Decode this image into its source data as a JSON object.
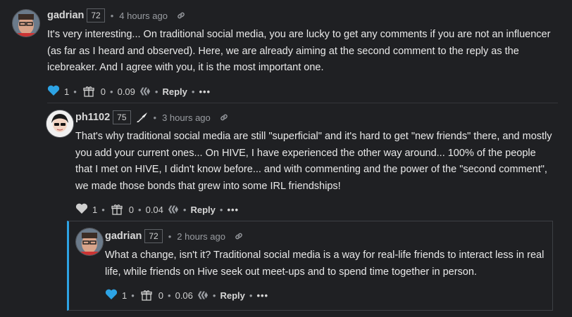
{
  "comments": [
    {
      "author": "gadrian",
      "reputation": "72",
      "time": "4 hours ago",
      "body": "It's very interesting... On traditional social media, you are lucky to get any comments if you are not an influencer (as far as I heard and observed). Here, we are already aiming at the second comment to the reply as the icebreaker. And I agree with you, it is the most important one.",
      "votes": "1",
      "gifts": "0",
      "payout": "0.09",
      "reply_label": "Reply",
      "more_label": "•••",
      "voted": true
    },
    {
      "author": "ph1102",
      "reputation": "75",
      "time": "3 hours ago",
      "body": "That's why traditional social media are still \"superficial\" and it's hard to get \"new friends\" there, and mostly you add your current ones... On HIVE, I have experienced the other way around... 100% of the people that I met on HIVE, I didn't know before... and with commenting and the power of the \"second comment\", we made those bonds that grew into some IRL friendships!",
      "votes": "1",
      "gifts": "0",
      "payout": "0.04",
      "reply_label": "Reply",
      "more_label": "•••",
      "voted": false
    },
    {
      "author": "gadrian",
      "reputation": "72",
      "time": "2 hours ago",
      "body": "What a change, isn't it? Traditional social media is a way for real-life friends to interact less in real life, while friends on Hive seek out meet-ups and to spend time together in person.",
      "votes": "1",
      "gifts": "0",
      "payout": "0.06",
      "reply_label": "Reply",
      "more_label": "•••",
      "voted": true
    }
  ],
  "separator": "•",
  "colors": {
    "background": "#1f2023",
    "voted_heart": "#2da3e4",
    "unvoted_heart": "#cfcfcf",
    "thread_accent": "#2da3e4"
  },
  "icons": [
    "heart-icon",
    "gift-icon",
    "hive-icon",
    "link-icon",
    "wing-icon",
    "more-icon"
  ]
}
